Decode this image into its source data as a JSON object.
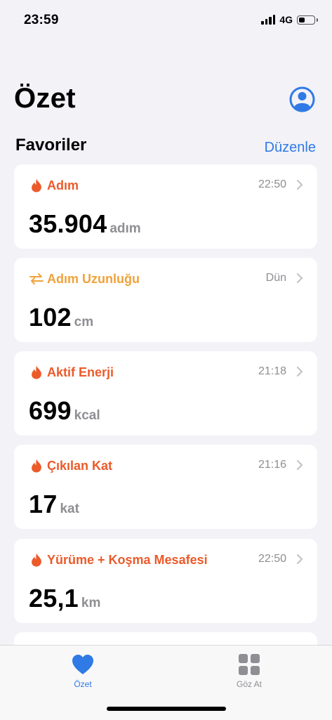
{
  "status_bar": {
    "time": "23:59",
    "network": "4G",
    "battery_level": 0.4
  },
  "header": {
    "title": "Özet"
  },
  "favorites": {
    "title": "Favoriler",
    "edit_label": "Düzenle",
    "cards": [
      {
        "label": "Adım",
        "time": "22:50",
        "value": "35.904",
        "unit": "adım",
        "icon": "flame-icon",
        "color": "#ec5a2a"
      },
      {
        "label": "Adım Uzunluğu",
        "time": "Dün",
        "value": "102",
        "unit": "cm",
        "icon": "step-length-icon",
        "color": "#f0a23a"
      },
      {
        "label": "Aktif Enerji",
        "time": "21:18",
        "value": "699",
        "unit": "kcal",
        "icon": "flame-icon",
        "color": "#ec5a2a"
      },
      {
        "label": "Çıkılan Kat",
        "time": "21:16",
        "value": "17",
        "unit": "kat",
        "icon": "flame-icon",
        "color": "#ec5a2a"
      },
      {
        "label": "Yürüme + Koşma Mesafesi",
        "time": "22:50",
        "value": "25,1",
        "unit": "km",
        "icon": "flame-icon",
        "color": "#ec5a2a"
      }
    ]
  },
  "tab_bar": {
    "tabs": [
      {
        "label": "Özet",
        "icon": "heart-icon",
        "selected": true,
        "color": "#2f7ae5"
      },
      {
        "label": "Göz At",
        "icon": "grid-icon",
        "selected": false,
        "color": "#8e8e93"
      }
    ]
  }
}
